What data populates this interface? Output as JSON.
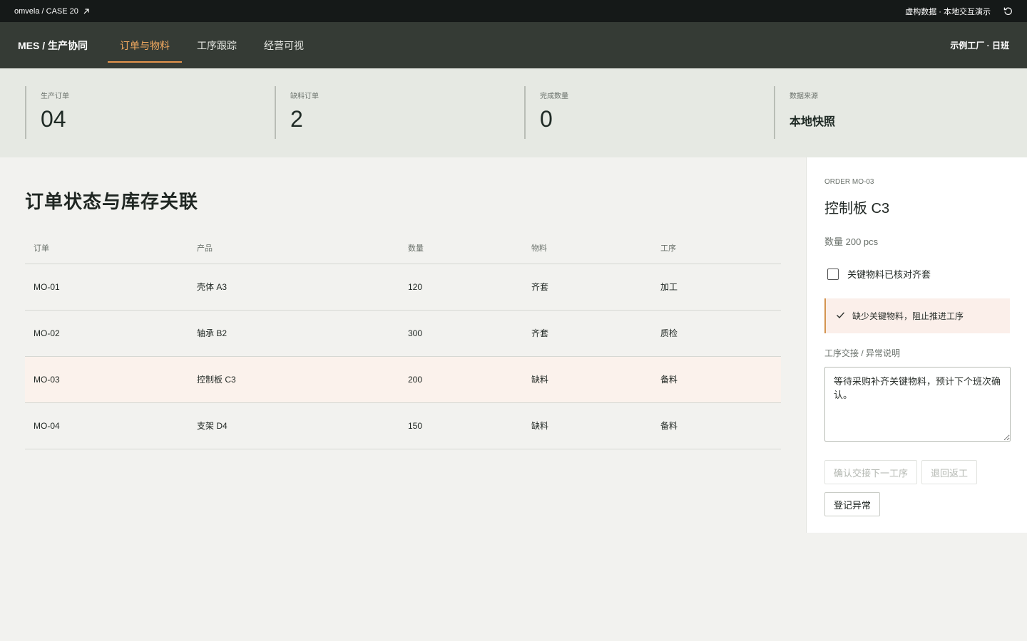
{
  "topbar": {
    "crumb": "omvela / CASE 20",
    "notice": "虚构数据 · 本地交互演示"
  },
  "nav": {
    "brand": "MES / 生产协同",
    "tabs": [
      "订单与物料",
      "工序跟踪",
      "经营可视"
    ],
    "factory": "示例工厂 · 日班"
  },
  "stats": [
    {
      "label": "生产订单",
      "value": "04"
    },
    {
      "label": "缺料订单",
      "value": "2"
    },
    {
      "label": "完成数量",
      "value": "0"
    },
    {
      "label": "数据来源",
      "value": "本地快照"
    }
  ],
  "main": {
    "title": "订单状态与库存关联",
    "columns": [
      "订单",
      "产品",
      "数量",
      "物料",
      "工序"
    ],
    "rows": [
      [
        "MO-01",
        "壳体 A3",
        "120",
        "齐套",
        "加工"
      ],
      [
        "MO-02",
        "轴承 B2",
        "300",
        "齐套",
        "质检"
      ],
      [
        "MO-03",
        "控制板 C3",
        "200",
        "缺料",
        "备料"
      ],
      [
        "MO-04",
        "支架 D4",
        "150",
        "缺料",
        "备料"
      ]
    ]
  },
  "panel": {
    "tag": "ORDER MO-03",
    "title": "控制板 C3",
    "qty": "数量 200 pcs",
    "check_label": "关键物料已核对齐套",
    "alert": "缺少关键物料，阻止推进工序",
    "field_label": "工序交接 / 异常说明",
    "note": "等待采购补齐关键物料，预计下个班次确认。",
    "confirm_label": "确认交接下一工序",
    "rework_label": "退回返工",
    "exception_label": "登记异常"
  },
  "colors": {
    "accent": "#f0a85f",
    "nav_bg": "#353b35",
    "topbar_bg": "#151918",
    "selected_row": "#fbf2ec"
  }
}
